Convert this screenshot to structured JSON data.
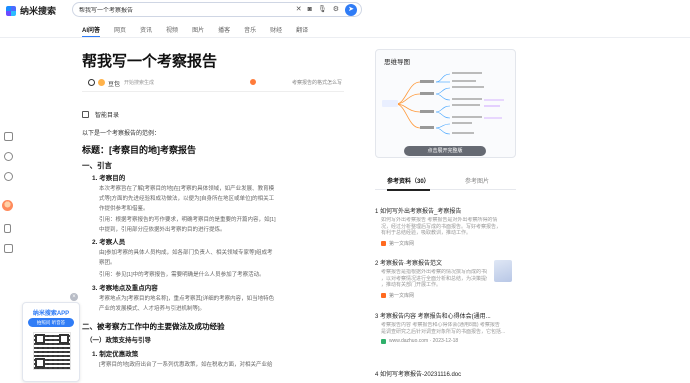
{
  "app": {
    "name": "纳米搜索"
  },
  "search": {
    "value": "帮我写一个考察报告"
  },
  "tabs": [
    "AI问答",
    "网页",
    "资讯",
    "视频",
    "图片",
    "播客",
    "音乐",
    "财经",
    "翻译"
  ],
  "article": {
    "title": "帮我写一个考察报告",
    "author": "豆包",
    "author_note": "开始搜索生成",
    "right_note": "考察报告的格式怎么写",
    "toc_label": "智能目录",
    "intro": "以下是一个考察报告的范例：",
    "heading": "标题：[考察目的地]考察报告",
    "section1": "一、引言",
    "s1_1": "1. 考察目的",
    "s1_1_body": [
      "本次考察旨在了解[考察目的地]在[考察的具体领域，如产业发展、教育模",
      "式等]方面的先进经验和成功做法，以便为[自身所在地区或单位]的相关工",
      "作提供参考和借鉴。",
      "引用：根据考察报告的写作要求，明确考察目的是重要的开篇内容，如[1]",
      "中提到，引用部分应依据外出考察的目的进行提炼。"
    ],
    "s1_2": "2. 考察人员",
    "s1_2_body": [
      "由[参加考察的具体人员构成，如各部门负责人、相关领域专家等]组成考",
      "察团。",
      "引用：参见[1]中的考察报告，需要明确是什么人员参加了考察活动。"
    ],
    "s1_3": "3. 考察地点及重点内容",
    "s1_3_body": [
      "考察地点为[考察目的地名称]，重点考察其[详细的考察内容，如当地特色",
      "产业的发展模式、人才培养与引进机制等]。"
    ],
    "section2": "二、被考察方工作中的主要做法及成功经验",
    "s2_sub": "（一）政策支持与引导",
    "s2_1": "1. 制定优惠政策",
    "s2_1_body": "[考察目的地]政府出台了一系列优惠政策，如在税收方面，对相关产业给"
  },
  "mindmap": {
    "title": "思维导图",
    "button": "点击展开完整版"
  },
  "refs": {
    "tab_active": "参考资料（30）",
    "tab_inactive": "参考图片",
    "items": [
      {
        "title": "1 如何写外出考察报告_考察报告",
        "body": [
          "如何写外出考察报告 考察报告是对外出考察所得的情",
          "况，经过分析整理后写成的书面报告。写好考察报告，",
          "有利于总结经验，吸取教训，推动工作。"
        ],
        "source": "第一文库网"
      },
      {
        "title": "2 考察报告·考察报告范文",
        "body": [
          "考察报告是指根据外出考察的情况撰写而成的书面文章",
          "，以对考察情况进行全面分析和总结，为决策提供依据",
          "，推动有关部门开展工作。"
        ],
        "source": "第一文库网"
      },
      {
        "title": "3 考察报告内容 考察报告和心得体会(通用...",
        "body": [
          "考察报告内容 考察报告和心得体会(通用8篇) 考察报告",
          "是调查研究之后针对调查对象所写的书面报告，它包括..."
        ],
        "source": "www.dazhuo.com · 2023-12-18"
      },
      {
        "title": "4 如何写考察报告-20231116.doc",
        "body": [],
        "source": ""
      }
    ]
  },
  "app_promo": {
    "title": "纳米搜索APP",
    "badge": "拍照问 听音答",
    "close": "×"
  },
  "icons": {
    "search_tools": [
      "camera-icon",
      "mic-icon",
      "settings-icon",
      "send-icon"
    ],
    "rail": [
      "history-icon",
      "star-icon",
      "gear-icon",
      "phone-icon",
      "edit-icon"
    ]
  }
}
